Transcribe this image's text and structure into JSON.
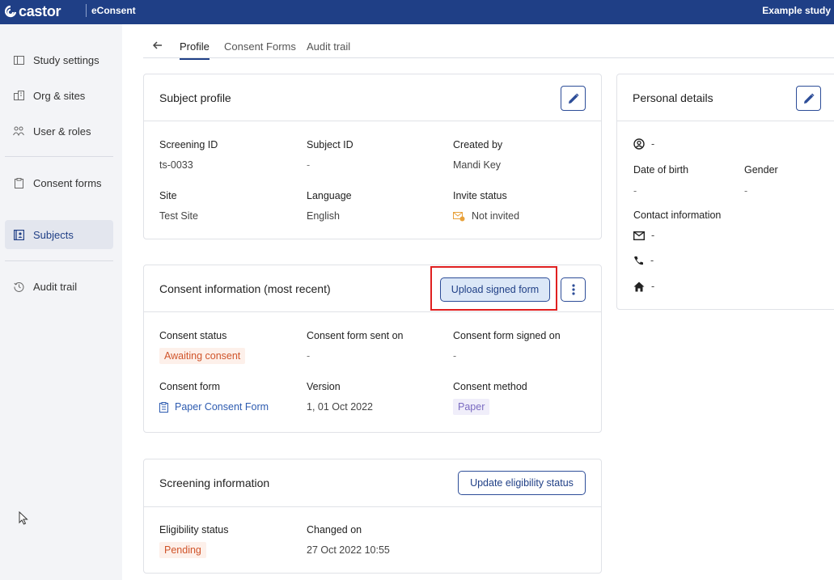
{
  "header": {
    "brand": "castor",
    "product": "eConsent",
    "study_name": "Example study",
    "colors": {
      "bar": "#1f3f86",
      "accent": "#2d4d98"
    }
  },
  "sidebar": {
    "items": [
      {
        "label": "Study settings",
        "icon": "panel-icon"
      },
      {
        "label": "Org & sites",
        "icon": "building-icon"
      },
      {
        "label": "User & roles",
        "icon": "users-icon"
      },
      {
        "label": "Consent forms",
        "icon": "clipboard-icon"
      },
      {
        "label": "Subjects",
        "icon": "contact-book-icon",
        "active": true
      },
      {
        "label": "Audit trail",
        "icon": "history-icon"
      }
    ]
  },
  "tabs": [
    {
      "label": "Profile",
      "active": true
    },
    {
      "label": "Consent Forms"
    },
    {
      "label": "Audit trail"
    }
  ],
  "subject_profile": {
    "title": "Subject profile",
    "fields": [
      {
        "label": "Screening ID",
        "value": "ts-0033"
      },
      {
        "label": "Subject ID",
        "value": "-"
      },
      {
        "label": "Created by",
        "value": "Mandi Key"
      },
      {
        "label": "Site",
        "value": "Test Site"
      },
      {
        "label": "Language",
        "value": "English"
      },
      {
        "label": "Invite status",
        "value": "Not invited",
        "icon": "mail-warning-icon"
      }
    ]
  },
  "consent_info": {
    "title": "Consent information (most recent)",
    "upload_button": "Upload signed form",
    "fields": [
      {
        "label": "Consent status",
        "value": "Awaiting consent",
        "status_color": "#d0542a"
      },
      {
        "label": "Consent form sent on",
        "value": "-"
      },
      {
        "label": "Consent form signed on",
        "value": "-"
      },
      {
        "label": "Consent form",
        "value": "Paper Consent Form",
        "icon": "clipboard-icon"
      },
      {
        "label": "Version",
        "value": "1, 01 Oct 2022"
      },
      {
        "label": "Consent method",
        "value": "Paper",
        "status_color": "#7a6bc1"
      }
    ]
  },
  "screening_info": {
    "title": "Screening information",
    "update_button": "Update eligibility status",
    "fields": [
      {
        "label": "Eligibility status",
        "value": "Pending",
        "status_color": "#d0542a"
      },
      {
        "label": "Changed on",
        "value": "27 Oct 2022 10:55"
      }
    ]
  },
  "personal_details": {
    "title": "Personal details",
    "name_value": "-",
    "dob_label": "Date of birth",
    "dob_value": "-",
    "gender_label": "Gender",
    "gender_value": "-",
    "contact_label": "Contact information",
    "email_value": "-",
    "phone_value": "-",
    "address_value": "-"
  }
}
